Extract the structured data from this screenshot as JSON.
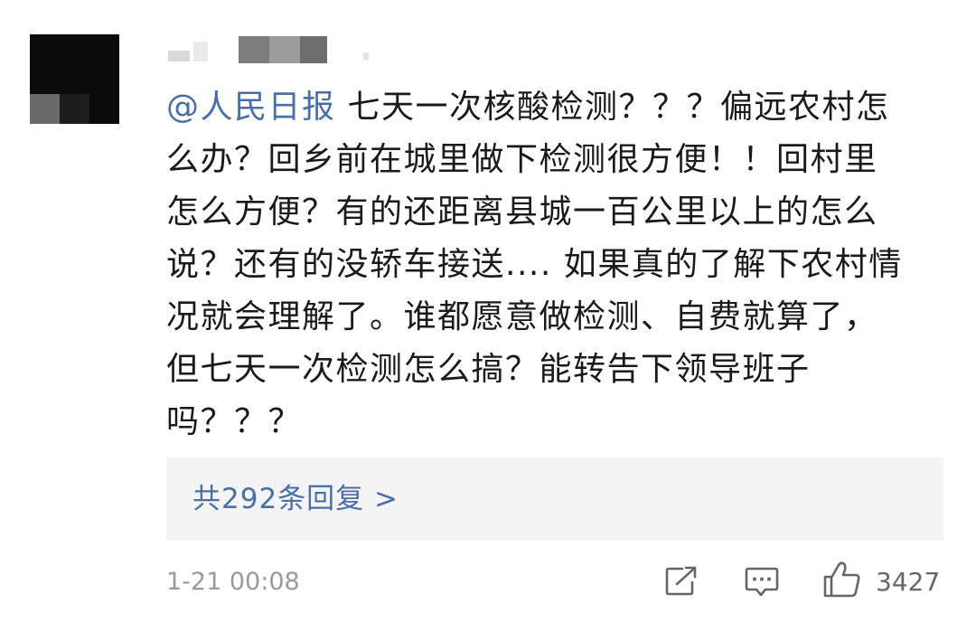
{
  "comment": {
    "mention": "@人民日报",
    "lines": [
      " 七天一次核酸检测？？？偏远农村怎",
      "么办？回乡前在城里做下检测很方便！！回村里",
      "怎么方便？有的还距离县城一百公里以上的怎么",
      "说？还有的没轿车接送.... 如果真的了解下农村情",
      "况就会理解了。谁都愿意做检测、自费就算了，",
      "但七天一次检测怎么搞？能转告下领导班子",
      "吗？？？"
    ]
  },
  "replies": {
    "label": "共292条回复 >"
  },
  "footer": {
    "timestamp": "1-21 00:08",
    "like_count": "3427"
  },
  "icons": {
    "share": "share-icon",
    "comment": "comment-icon",
    "like": "thumbs-up-icon"
  },
  "colors": {
    "link": "#4a6fa5",
    "text": "#1a1a1a",
    "meta": "#9a9a9a",
    "panel": "#f4f4f4"
  }
}
